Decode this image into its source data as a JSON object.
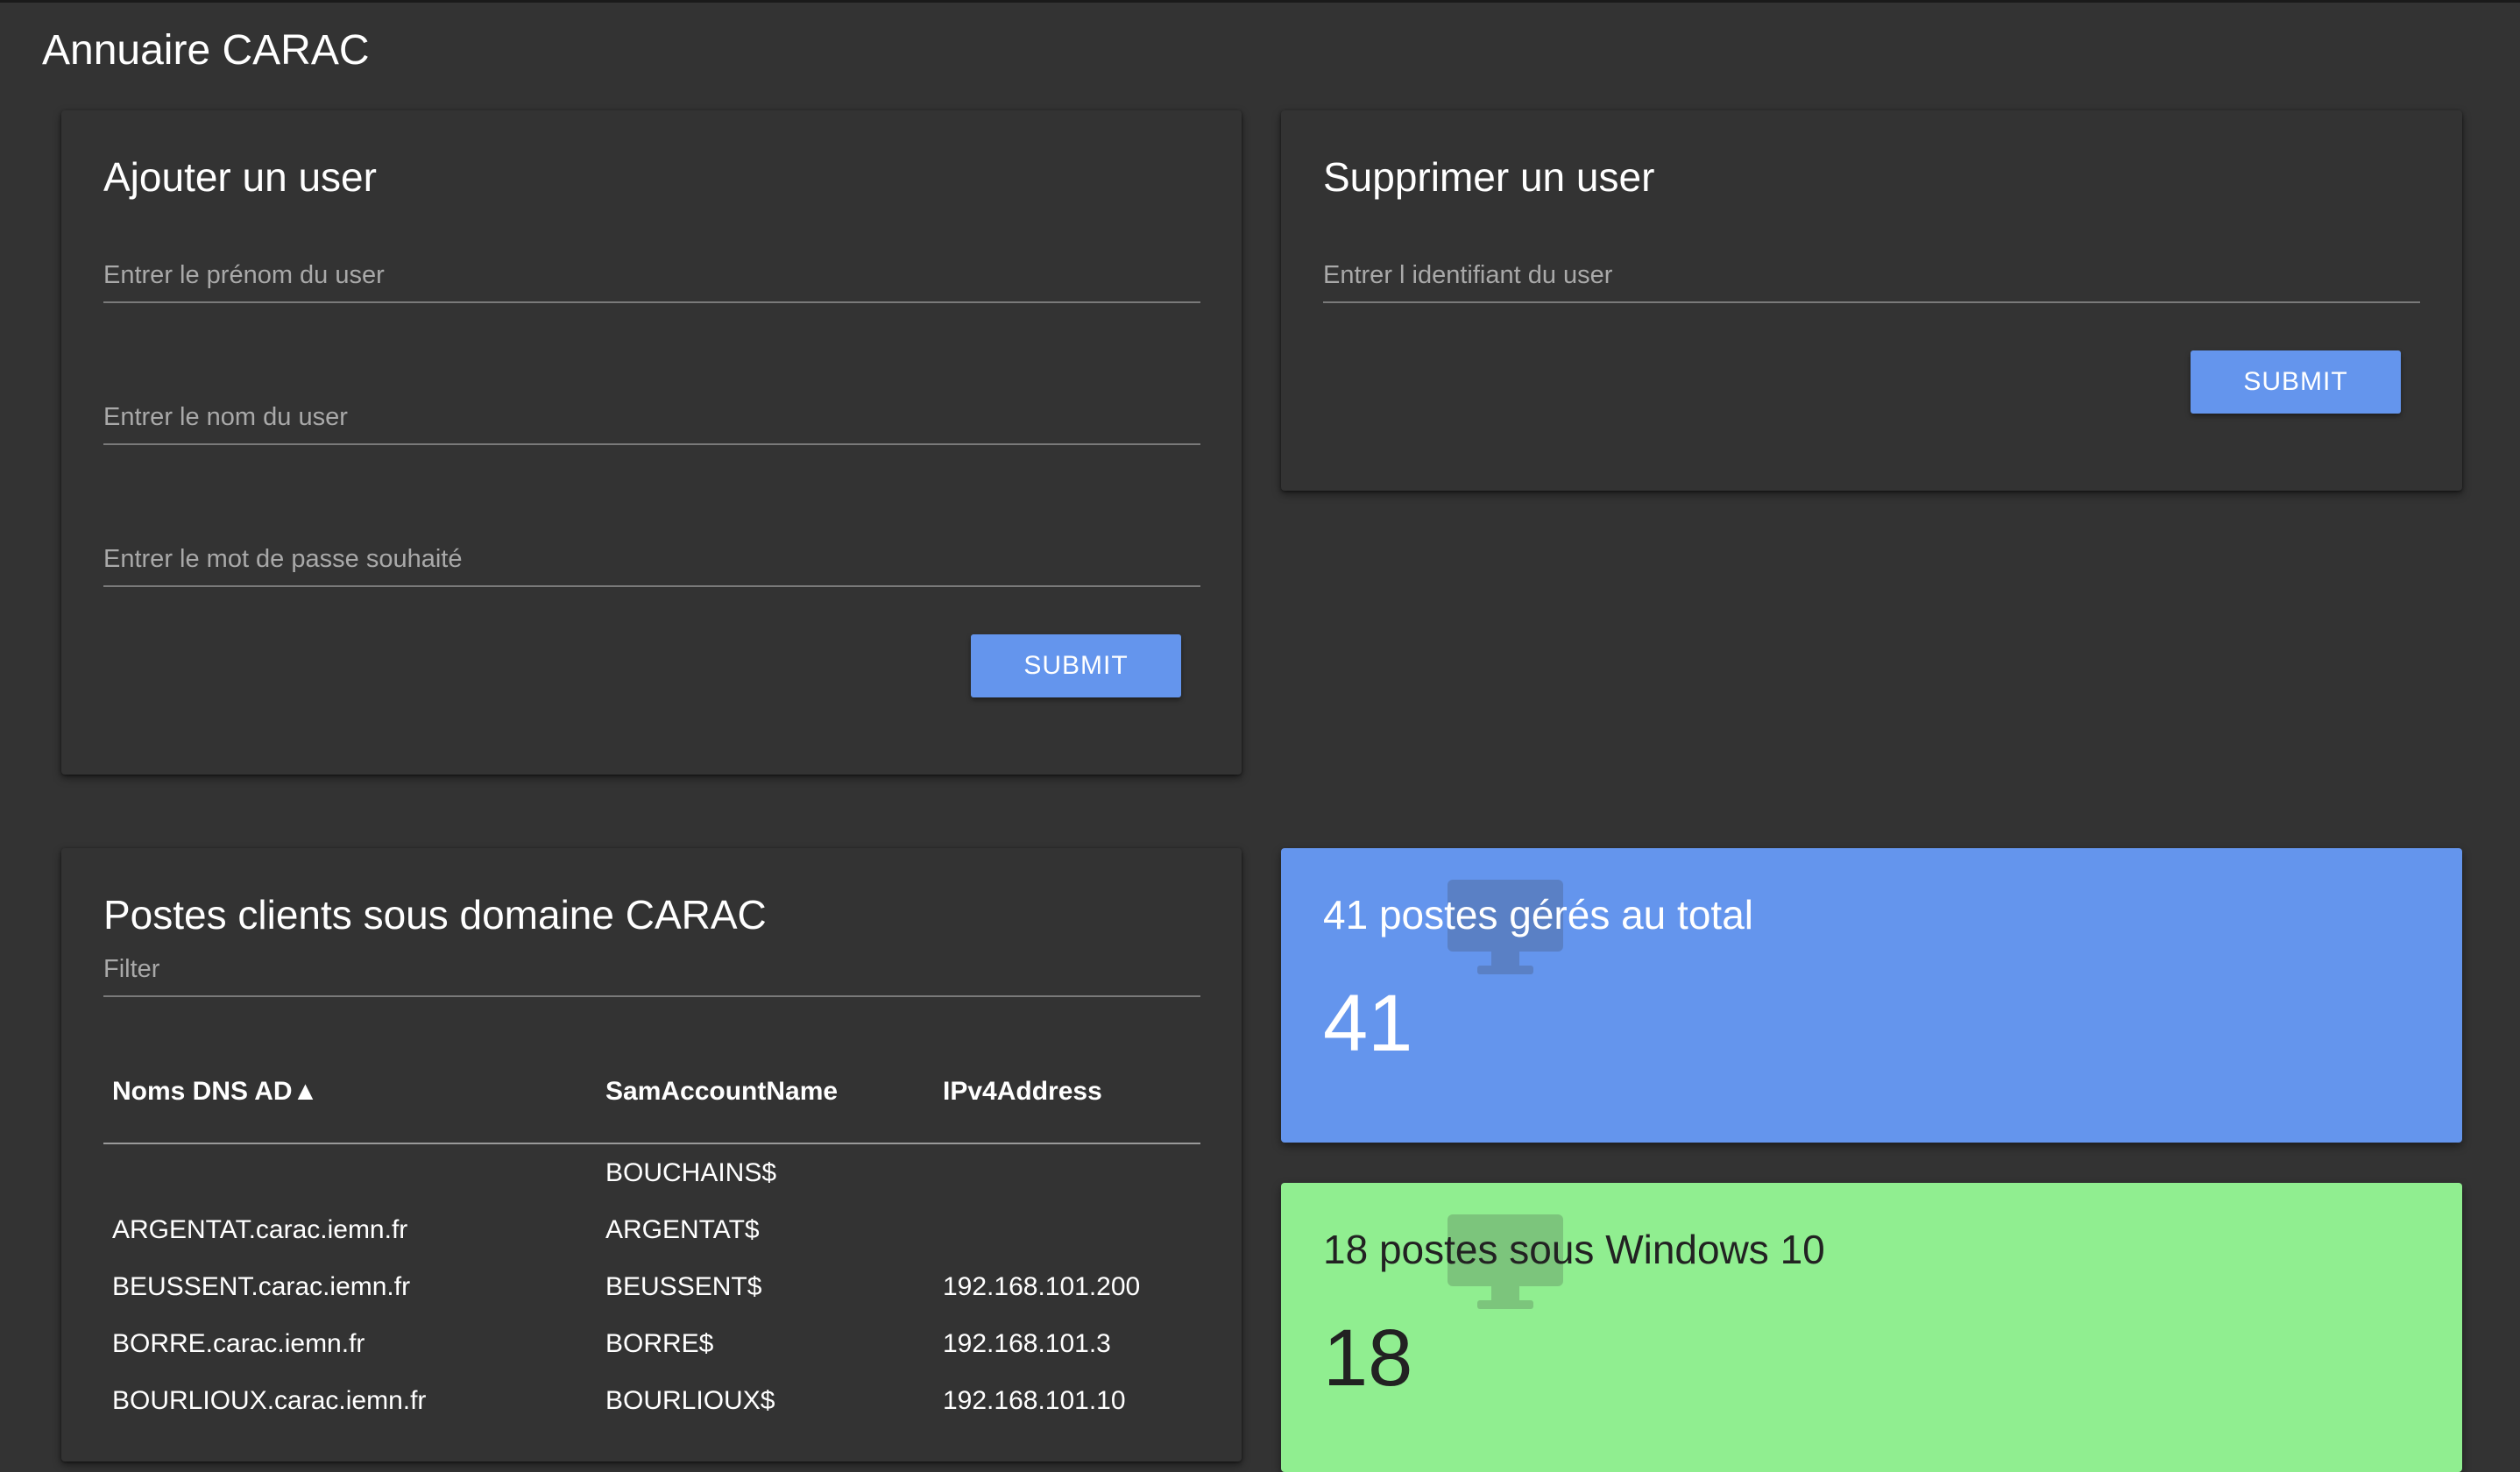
{
  "app": {
    "title": "Annuaire CARAC"
  },
  "add_user": {
    "title": "Ajouter un user",
    "firstname_placeholder": "Entrer le prénom du user",
    "lastname_placeholder": "Entrer le nom du user",
    "password_placeholder": "Entrer le mot de passe souhaité",
    "submit_label": "SUBMIT"
  },
  "delete_user": {
    "title": "Supprimer un user",
    "id_placeholder": "Entrer l identifiant du user",
    "submit_label": "SUBMIT"
  },
  "clients": {
    "title": "Postes clients sous domaine CARAC",
    "filter_placeholder": "Filter",
    "columns": [
      "Noms DNS AD▲",
      "SamAccountName",
      "IPv4Address"
    ],
    "rows": [
      [
        "",
        "BOUCHAINS$",
        ""
      ],
      [
        "ARGENTAT.carac.iemn.fr",
        "ARGENTAT$",
        ""
      ],
      [
        "BEUSSENT.carac.iemn.fr",
        "BEUSSENT$",
        "192.168.101.200"
      ],
      [
        "BORRE.carac.iemn.fr",
        "BORRE$",
        "192.168.101.3"
      ],
      [
        "BOURLIOUX.carac.iemn.fr",
        "BOURLIOUX$",
        "192.168.101.10"
      ]
    ]
  },
  "stats": [
    {
      "title": "41 postes gérés au total",
      "value": "41",
      "color": "#6495ed",
      "text_color": "#ffffff",
      "icon": "monitor-icon"
    },
    {
      "title": "18 postes sous Windows 10",
      "value": "18",
      "color": "#90ee90",
      "text_color": "#222222",
      "icon": "monitor-icon"
    }
  ]
}
